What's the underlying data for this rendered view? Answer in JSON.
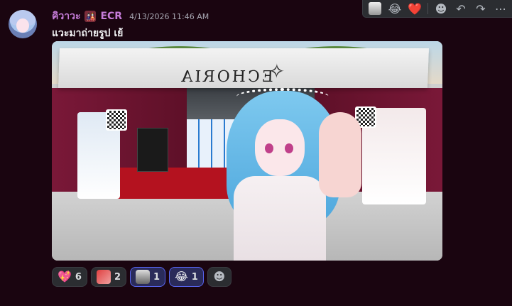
{
  "message": {
    "username": "คิวาวะ",
    "role_icon": "🎎",
    "tag": "ECR",
    "timestamp": "4/13/2026 11:46 AM",
    "text": "แวะมาถ่ายรูป เย้",
    "avatar": "avatar-image"
  },
  "hover_toolbar": {
    "items": [
      {
        "name": "custom-emoji-reaction",
        "emoji": ""
      },
      {
        "name": "laughing-emoji",
        "emoji": "😂"
      },
      {
        "name": "heart-emoji",
        "emoji": "❤️"
      },
      {
        "name": "add-reaction-icon",
        "emoji": "☻"
      },
      {
        "name": "reply-icon",
        "emoji": "↶"
      },
      {
        "name": "forward-icon",
        "emoji": "↷"
      },
      {
        "name": "more-icon",
        "emoji": "⋯"
      }
    ]
  },
  "attachment": {
    "booth_sign": "ECHORIA",
    "logo": "✧"
  },
  "reactions": [
    {
      "emoji": "💖",
      "count": "6",
      "active": false
    },
    {
      "emoji": "custom-image",
      "count": "2",
      "active": false
    },
    {
      "emoji": "custom-image",
      "count": "1",
      "active": true
    },
    {
      "emoji": "😂",
      "count": "1",
      "active": true
    }
  ],
  "add_reaction_label": "☻",
  "colors": {
    "background": "#1a0510",
    "username": "#c77dda",
    "active_reaction_border": "#5865f2"
  }
}
